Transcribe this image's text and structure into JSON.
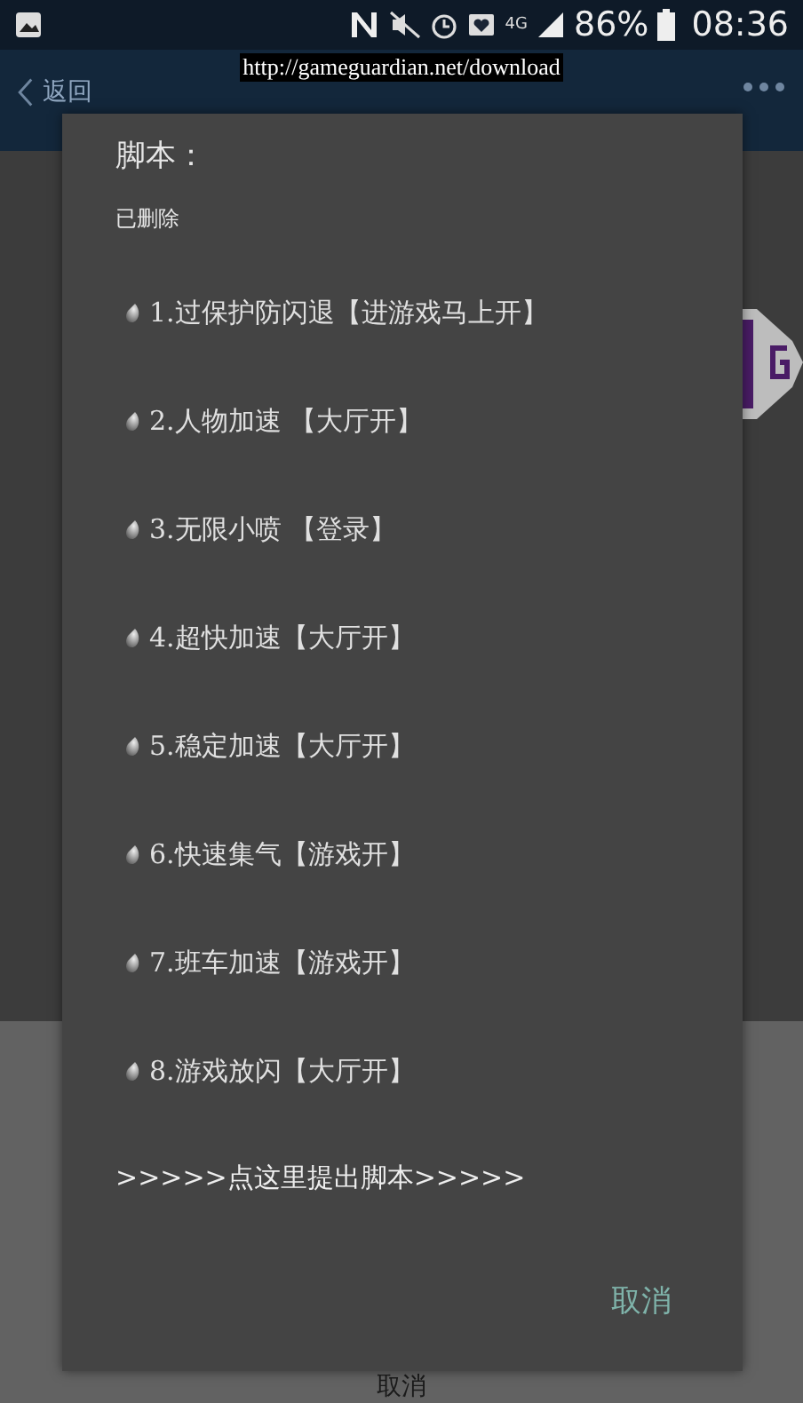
{
  "status_bar": {
    "network": "4G",
    "battery": "86%",
    "time": "08:36"
  },
  "url_banner": "http://gameguardian.net/download",
  "app_bar": {
    "back_label": "返回"
  },
  "background_sheet": {
    "cancel": "取消"
  },
  "dialog": {
    "title": "脚本：",
    "subtitle": "已删除",
    "items": [
      {
        "label": "1.过保护防闪退【进游戏马上开】"
      },
      {
        "label": "2.人物加速 【大厅开】"
      },
      {
        "label": "3.无限小喷 【登录】"
      },
      {
        "label": "4.超快加速【大厅开】"
      },
      {
        "label": "5.稳定加速【大厅开】"
      },
      {
        "label": "6.快速集气【游戏开】"
      },
      {
        "label": "7.班车加速【游戏开】"
      },
      {
        "label": "8.游戏放闪【大厅开】"
      }
    ],
    "link": ">>>>>点这里提出脚本>>>>>",
    "cancel_button": "取消"
  }
}
